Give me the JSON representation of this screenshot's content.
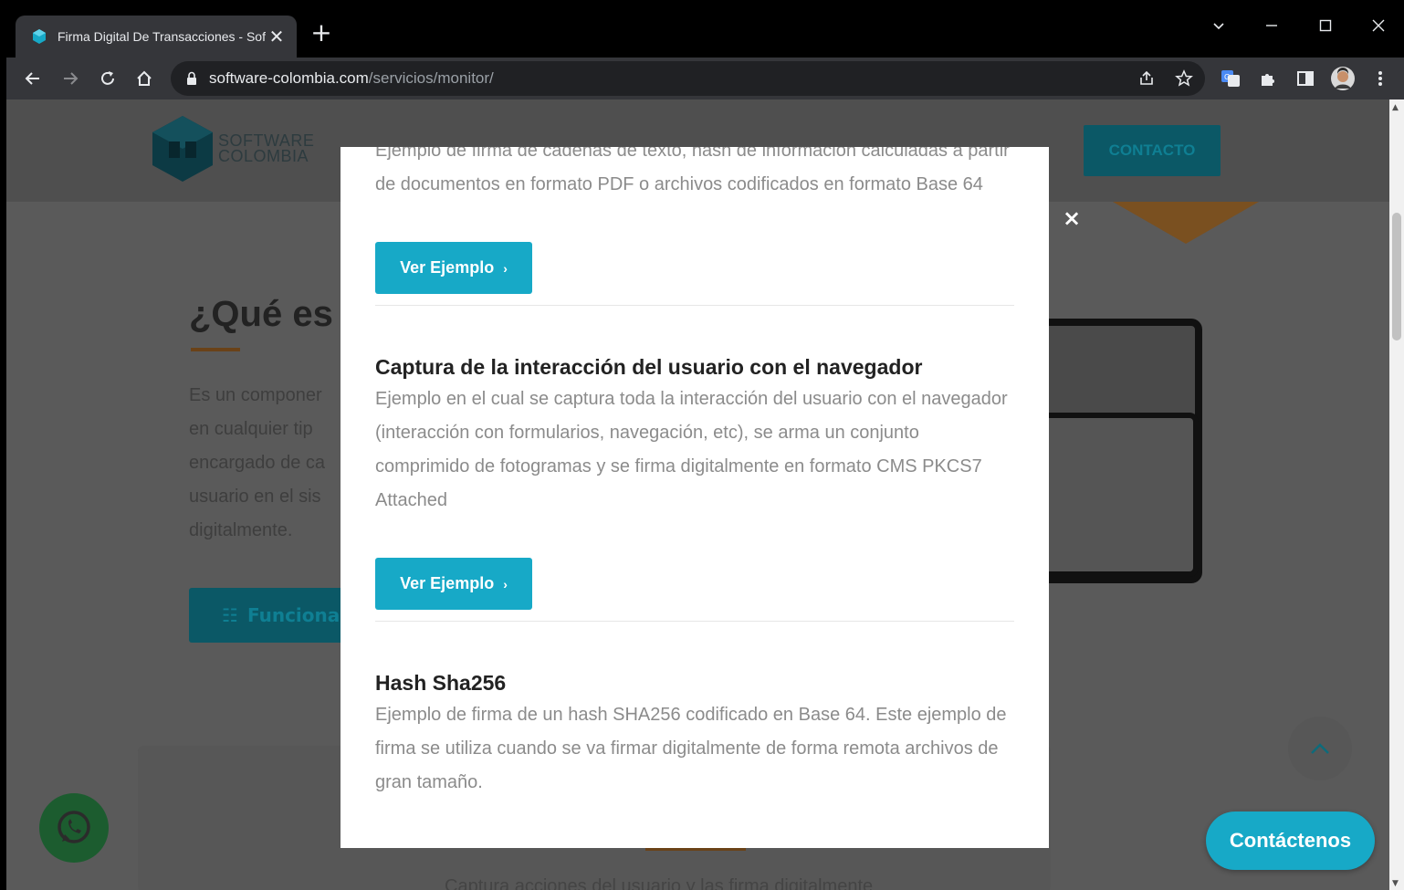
{
  "browser": {
    "tab_title": "Firma Digital De Transacciones - Software Colombia",
    "new_tab": "+",
    "tab_close": "✕",
    "url_domain": "software-colombia.com",
    "url_path": "/servicios/monitor/"
  },
  "site": {
    "logo_line1": "SOFTWARE",
    "logo_line2": "COLOMBIA",
    "contact_button": "CONTACTO",
    "heading": "¿Qué es",
    "paragraph_lines": [
      "Es un componer",
      "en cualquier tip",
      "encargado de ca",
      "usuario en el sis",
      "digitalmente."
    ],
    "function_button": "Funciona",
    "bottom_text": "Captura acciones del usuario y las firma digitalmente",
    "contact_fab": "Contáctenos"
  },
  "modal": {
    "close_label": "×",
    "items": [
      {
        "title": "",
        "description": "Ejemplo de firma de cadenas de texto, hash de información calculadas a partir de documentos en formato PDF o archivos codificados en formato Base 64",
        "button": "Ver Ejemplo"
      },
      {
        "title": "Captura de la interacción del usuario con el navegador",
        "description": "Ejemplo en el cual se captura toda la interacción del usuario con el navegador (interacción con formularios, navegación, etc), se arma un conjunto comprimido de fotogramas y se firma digitalmente en formato CMS PKCS7 Attached",
        "button": "Ver Ejemplo"
      },
      {
        "title": "Hash Sha256",
        "description": "Ejemplo de firma de un hash SHA256 codificado en Base 64. Este ejemplo de firma se utiliza cuando se va firmar digitalmente de forma remota archivos de gran tamaño.",
        "button": ""
      }
    ]
  },
  "colors": {
    "accent": "#17a9c7",
    "overlay_dim": "#5a5a5a",
    "brand_dark": "#0b5866",
    "orange": "#c97a27"
  }
}
